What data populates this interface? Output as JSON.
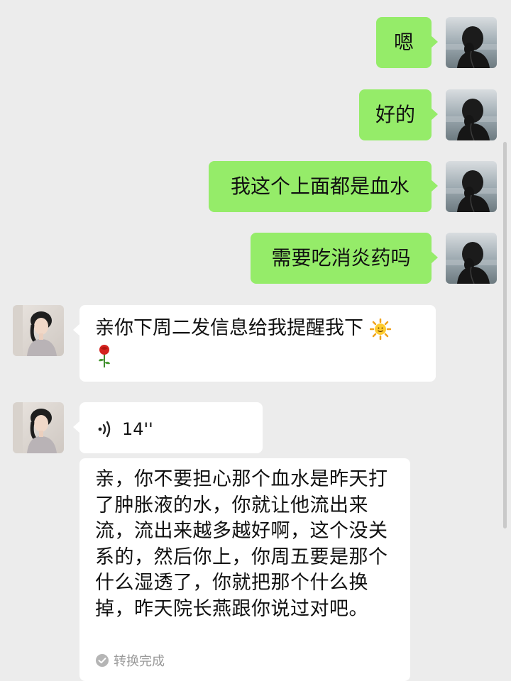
{
  "messages": [
    {
      "direction": "out",
      "text": "嗯"
    },
    {
      "direction": "out",
      "text": "好的"
    },
    {
      "direction": "out",
      "text": "我这个上面都是血水"
    },
    {
      "direction": "out",
      "text": "需要吃消炎药吗"
    },
    {
      "direction": "in",
      "text": "亲你下周二发信息给我提醒我下",
      "emojis": [
        "sun-emoji",
        "rose-emoji"
      ]
    },
    {
      "direction": "in",
      "type": "voice",
      "duration": "14''",
      "transcript": "亲，你不要担心那个血水是昨天打了肿胀液的水，你就让他流出来流，流出来越多越好啊，这个没关系的，然后你上，你周五要是那个什么湿透了，你就把那个什么换掉，昨天院长燕跟你说过对吧。",
      "status": "转换完成"
    }
  ],
  "colors": {
    "background": "#ececec",
    "outgoing_bubble": "#95ec69",
    "incoming_bubble": "#ffffff",
    "status_text": "#9a9a9a"
  },
  "icons": [
    "user-avatar",
    "contact-avatar",
    "voice-wave-icon",
    "check-circle-icon"
  ]
}
